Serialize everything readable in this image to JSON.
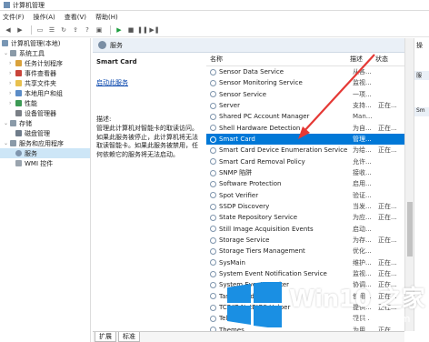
{
  "window": {
    "title": "计算机管理"
  },
  "menu": [
    "文件(F)",
    "操作(A)",
    "查看(V)",
    "帮助(H)"
  ],
  "toolbar": {
    "buttons": [
      "back-icon",
      "forward-icon",
      "folder-icon",
      "list-icon",
      "refresh-icon",
      "export-icon",
      "help-icon",
      "properties-icon",
      "play-icon",
      "stop-icon",
      "pause-icon",
      "restart-icon"
    ]
  },
  "tree": {
    "root": "计算机管理(本地)",
    "items": [
      {
        "label": "系统工具",
        "level": 1,
        "expand": "⌄"
      },
      {
        "label": "任务计划程序",
        "level": 2,
        "expand": "›"
      },
      {
        "label": "事件查看器",
        "level": 2,
        "expand": "›"
      },
      {
        "label": "共享文件夹",
        "level": 2,
        "expand": "›"
      },
      {
        "label": "本地用户和组",
        "level": 2,
        "expand": "›"
      },
      {
        "label": "性能",
        "level": 2,
        "expand": "›"
      },
      {
        "label": "设备管理器",
        "level": 2,
        "expand": ""
      },
      {
        "label": "存储",
        "level": 1,
        "expand": "⌄"
      },
      {
        "label": "磁盘管理",
        "level": 2,
        "expand": ""
      },
      {
        "label": "服务和应用程序",
        "level": 1,
        "expand": "⌄"
      },
      {
        "label": "服务",
        "level": 2,
        "expand": "",
        "selected": true
      },
      {
        "label": "WMI 控件",
        "level": 2,
        "expand": ""
      }
    ]
  },
  "header": {
    "title": "服务"
  },
  "description": {
    "service_name": "Smart Card",
    "link": "启动此服务",
    "desc_title": "描述:",
    "desc_text": [
      "管理此计算机对智能卡的取读访问。",
      "如果此服务被停止，此计算机将无法",
      "取读智能卡。如果此服务被禁用，任",
      "何依赖它的服务将无法启动。"
    ]
  },
  "list": {
    "columns": {
      "name": "名称",
      "desc": "描述",
      "status": "状态"
    },
    "rows": [
      {
        "name": "Sensor Data Service",
        "desc": "从各...",
        "status": ""
      },
      {
        "name": "Sensor Monitoring Service",
        "desc": "监视...",
        "status": ""
      },
      {
        "name": "Sensor Service",
        "desc": "一项...",
        "status": ""
      },
      {
        "name": "Server",
        "desc": "支持...",
        "status": "正在..."
      },
      {
        "name": "Shared PC Account Manager",
        "desc": "Man...",
        "status": ""
      },
      {
        "name": "Shell Hardware Detection",
        "desc": "为自...",
        "status": "正在..."
      },
      {
        "name": "Smart Card",
        "desc": "管理...",
        "status": "",
        "selected": true
      },
      {
        "name": "Smart Card Device Enumeration Service",
        "desc": "为给...",
        "status": "正在..."
      },
      {
        "name": "Smart Card Removal Policy",
        "desc": "允许...",
        "status": ""
      },
      {
        "name": "SNMP 陷阱",
        "desc": "接收...",
        "status": ""
      },
      {
        "name": "Software Protection",
        "desc": "启用...",
        "status": ""
      },
      {
        "name": "Spot Verifier",
        "desc": "验证...",
        "status": ""
      },
      {
        "name": "SSDP Discovery",
        "desc": "当发...",
        "status": "正在..."
      },
      {
        "name": "State Repository Service",
        "desc": "为应...",
        "status": "正在..."
      },
      {
        "name": "Still Image Acquisition Events",
        "desc": "启动...",
        "status": ""
      },
      {
        "name": "Storage Service",
        "desc": "为存...",
        "status": "正在..."
      },
      {
        "name": "Storage Tiers Management",
        "desc": "优化...",
        "status": ""
      },
      {
        "name": "SysMain",
        "desc": "维护...",
        "status": "正在..."
      },
      {
        "name": "System Event Notification Service",
        "desc": "监视...",
        "status": "正在..."
      },
      {
        "name": "System Events Broker",
        "desc": "协调...",
        "status": "正在..."
      },
      {
        "name": "Task Scheduler",
        "desc": "使用...",
        "status": "正在..."
      },
      {
        "name": "TCP/IP NetBIOS Helper",
        "desc": "提供...",
        "status": "正在..."
      },
      {
        "name": "Telephony",
        "desc": "提供...",
        "status": ""
      },
      {
        "name": "Themes",
        "desc": "为用...",
        "status": "正在..."
      }
    ]
  },
  "actions": {
    "label": "操",
    "item1": "服",
    "item2": "Sm"
  },
  "tabs": [
    "扩展",
    "标准"
  ],
  "watermark": {
    "brand": "Win10 之家",
    "url": "www.win10xitong.com"
  },
  "colors": {
    "selection": "#0078d7",
    "arrow": "#e53935",
    "logo_blue": "#1a8fe3"
  }
}
